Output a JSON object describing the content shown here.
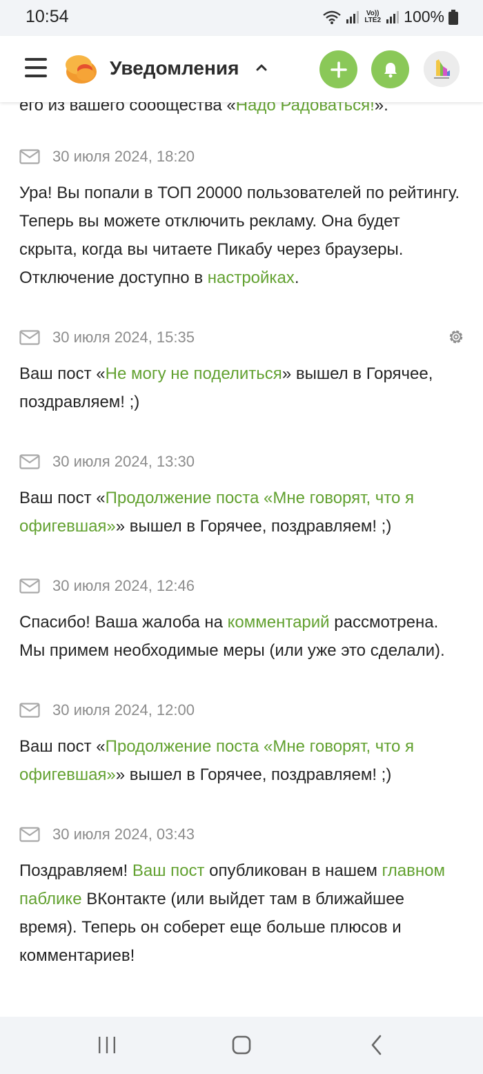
{
  "status_bar": {
    "time": "10:54",
    "network": "Vo)) LTE2",
    "battery": "100%"
  },
  "header": {
    "title": "Уведомления"
  },
  "colors": {
    "accent": "#8ac858",
    "link": "#62a130",
    "date": "#8c8c8c"
  },
  "top_fragment": {
    "text_before": "его из вашего сообщества «",
    "link": "Надо Радоваться!",
    "text_after": "»."
  },
  "notifications": [
    {
      "date": "30 июля 2024, 18:20",
      "has_settings": false,
      "parts": [
        {
          "text": "Ура! Вы попали в ТОП 20000 пользователей по рейтингу. Теперь вы можете отключить рекламу. Она будет скрыта, когда вы читаете Пикабу через браузеры. Отключение доступно в "
        },
        {
          "text": "настройках",
          "link": true
        },
        {
          "text": "."
        }
      ]
    },
    {
      "date": "30 июля 2024, 15:35",
      "has_settings": true,
      "parts": [
        {
          "text": "Ваш пост «"
        },
        {
          "text": "Не могу не поделиться",
          "link": true
        },
        {
          "text": "» вышел в Горячее, поздравляем! ;)"
        }
      ]
    },
    {
      "date": "30 июля 2024, 13:30",
      "has_settings": false,
      "parts": [
        {
          "text": "Ваш пост «"
        },
        {
          "text": "Продолжение поста «Мне говорят, что я офигевшая»",
          "link": true
        },
        {
          "text": "» вышел в Горячее, поздравляем! ;)"
        }
      ]
    },
    {
      "date": "30 июля 2024, 12:46",
      "has_settings": false,
      "parts": [
        {
          "text": "Спасибо! Ваша жалоба на "
        },
        {
          "text": "комментарий",
          "link": true
        },
        {
          "text": " рассмотрена. Мы примем необходимые меры (или уже это сделали)."
        }
      ]
    },
    {
      "date": "30 июля 2024, 12:00",
      "has_settings": false,
      "parts": [
        {
          "text": "Ваш пост «"
        },
        {
          "text": "Продолжение поста «Мне говорят, что я офигевшая»",
          "link": true
        },
        {
          "text": "» вышел в Горячее, поздравляем! ;)"
        }
      ]
    },
    {
      "date": "30 июля 2024, 03:43",
      "has_settings": false,
      "parts": [
        {
          "text": "Поздравляем! "
        },
        {
          "text": "Ваш пост",
          "link": true
        },
        {
          "text": " опубликован в нашем "
        },
        {
          "text": "главном паблике",
          "link": true
        },
        {
          "text": " ВКонтакте (или выйдет там в ближайшее время). Теперь он соберет еще больше плюсов и комментариев!"
        }
      ]
    }
  ],
  "nav": {
    "icons": [
      "recent-apps-icon",
      "home-icon",
      "back-icon"
    ]
  }
}
